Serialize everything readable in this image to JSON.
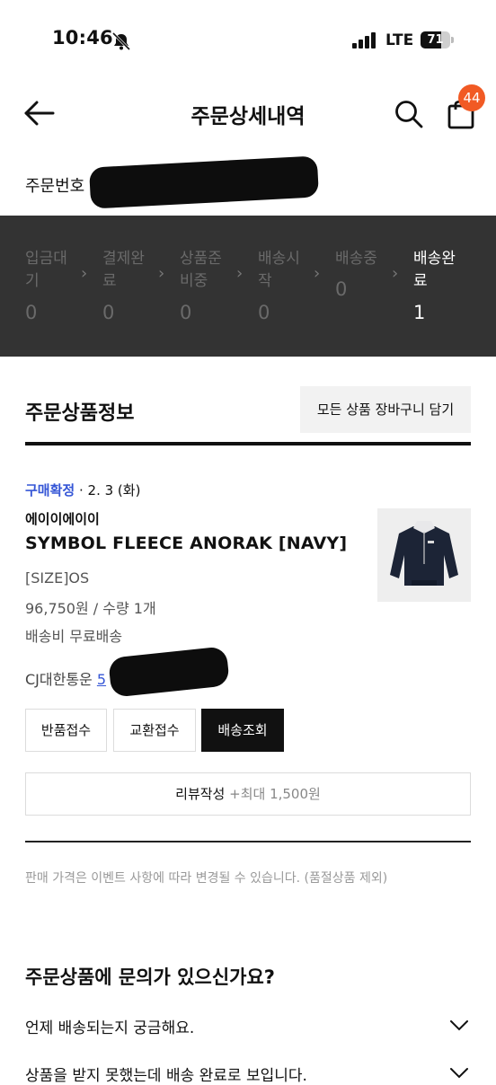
{
  "status_bar": {
    "time": "10:46",
    "network": "LTE",
    "battery_level": "71",
    "battery_fraction": 0.71
  },
  "header": {
    "title": "주문상세내역",
    "cart_badge": "44"
  },
  "order": {
    "number_label": "주문번호"
  },
  "progress_steps": [
    {
      "label": "입금대\n기",
      "count": "0"
    },
    {
      "label": "결제완\n료",
      "count": "0"
    },
    {
      "label": "상품준\n비중",
      "count": "0"
    },
    {
      "label": "배송시\n작",
      "count": "0"
    },
    {
      "label": "배송중",
      "count": "0"
    },
    {
      "label": "배송완\n료",
      "count": "1"
    }
  ],
  "product_section": {
    "title": "주문상품정보",
    "add_all_to_cart": "모든 상품 장바구니 담기"
  },
  "product": {
    "status_label": "구매확정",
    "status_date": "· 2. 3 (화)",
    "brand": "에이이에이이",
    "name": "SYMBOL FLEECE ANORAK [NAVY]",
    "option": "[SIZE]OS",
    "price_qty": "96,750원 / 수량 1개",
    "shipping": "배송비 무료배송",
    "carrier": "CJ대한통운",
    "tracking_prefix": "5"
  },
  "actions": {
    "return": "반품접수",
    "exchange": "교환접수",
    "track": "배송조회"
  },
  "review": {
    "label": "리뷰작성",
    "sub": "+최대 1,500원"
  },
  "notice": "판매 가격은 이벤트 사항에 따라 변경될 수 있습니다. (품절상품 제외)",
  "faq": {
    "title": "주문상품에 문의가 있으신가요?",
    "items": [
      "언제 배송되는지 궁금해요.",
      "상품을 받지 못했는데 배송 완료로 보입니다."
    ]
  },
  "colors": {
    "progress_bg": "#333333",
    "accent_blue": "#3556d6",
    "badge_orange": "#f15a24"
  }
}
